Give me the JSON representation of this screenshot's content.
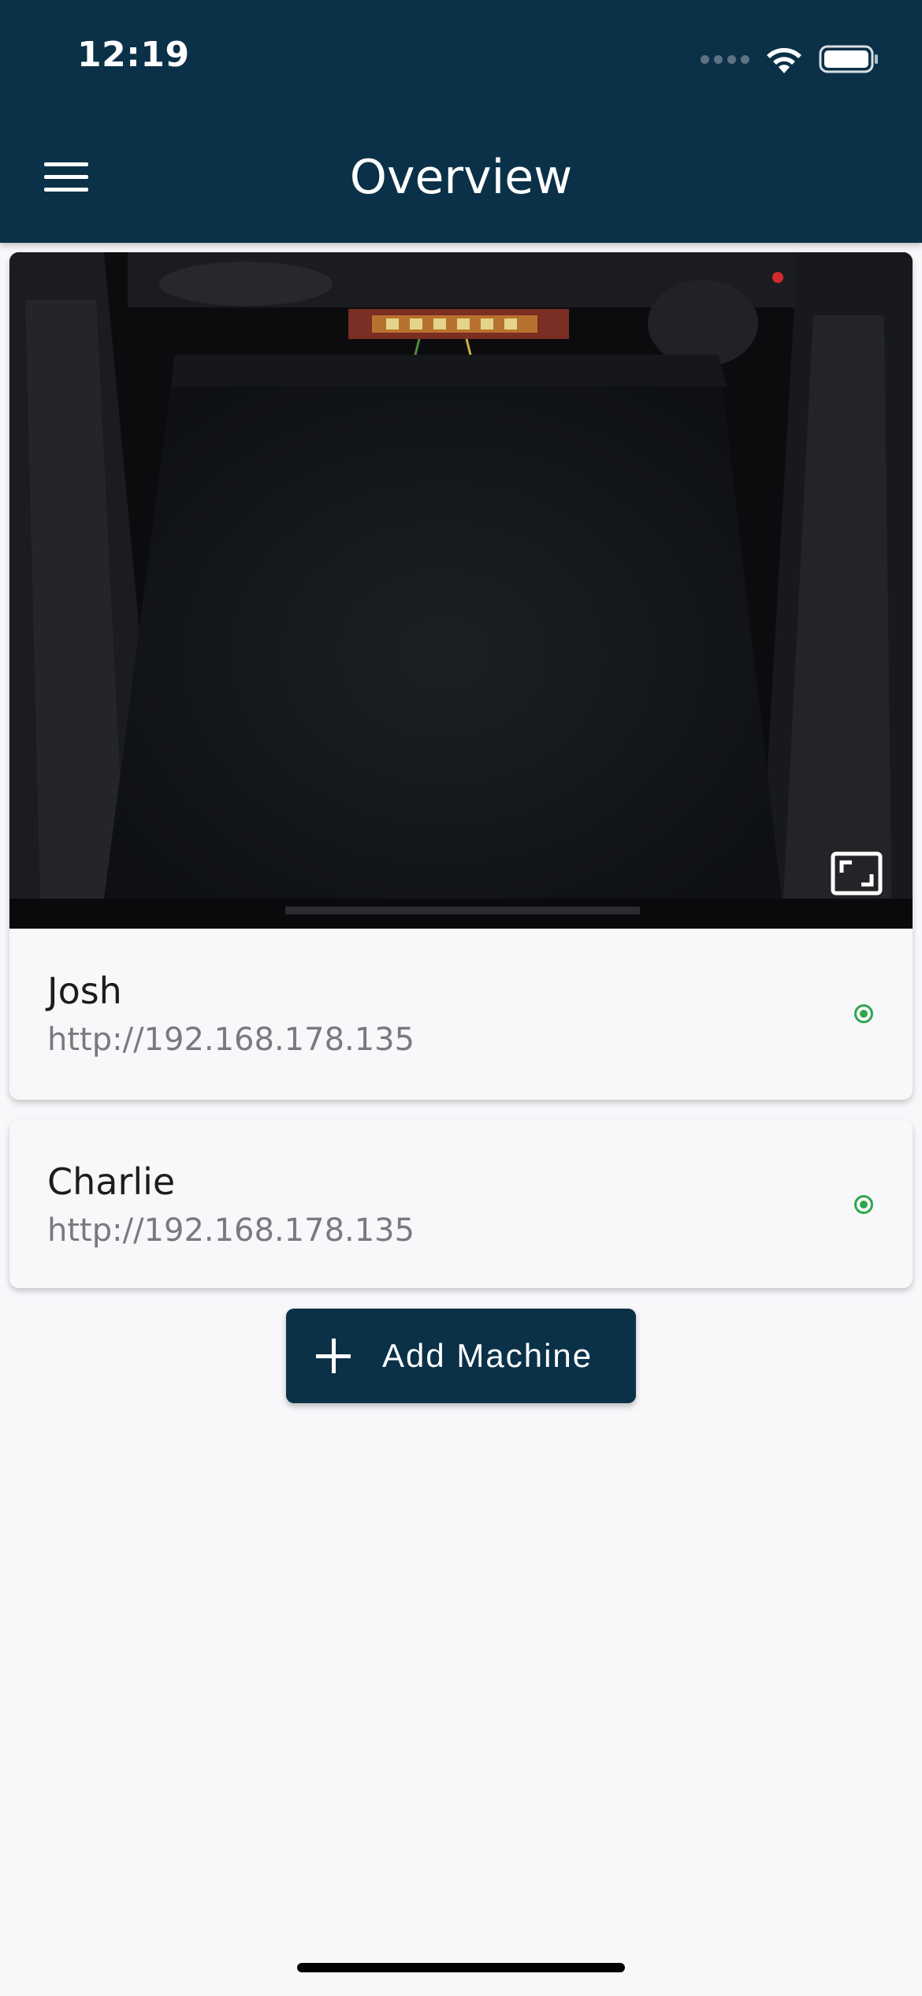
{
  "status_bar": {
    "time": "12:19"
  },
  "header": {
    "title": "Overview"
  },
  "machines": [
    {
      "name": "Josh",
      "url": "http://192.168.178.135",
      "status": "online"
    },
    {
      "name": "Charlie",
      "url": "http://192.168.178.135",
      "status": "online"
    }
  ],
  "actions": {
    "add_machine_label": "Add Machine"
  },
  "colors": {
    "header": "#0b3148",
    "status_online": "#2ea64a",
    "background": "#f8f8fb"
  },
  "icons": [
    "menu-icon",
    "wifi-icon",
    "battery-icon",
    "fullscreen-icon",
    "plus-icon"
  ]
}
